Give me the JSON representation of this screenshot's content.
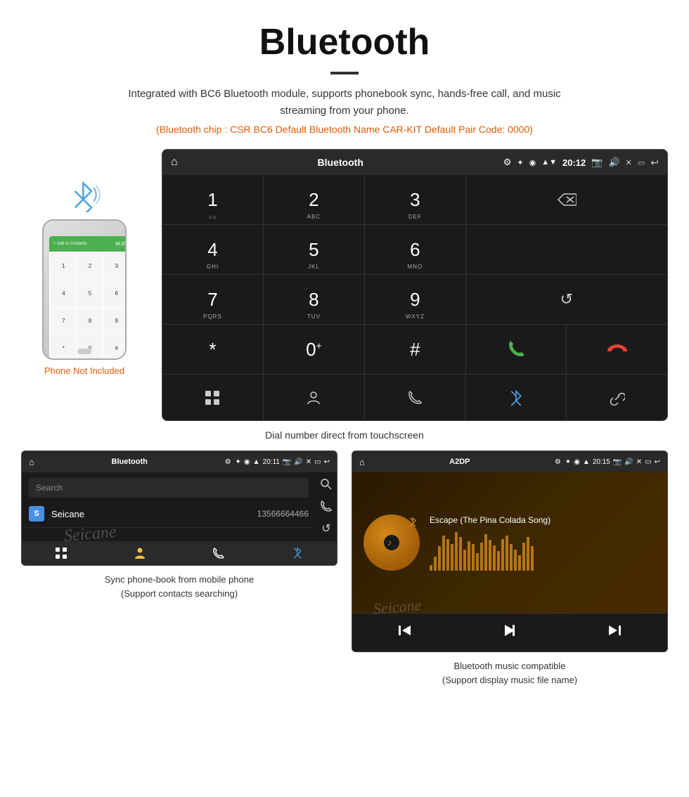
{
  "header": {
    "title": "Bluetooth",
    "desc": "Integrated with BC6 Bluetooth module, supports phonebook sync, hands-free call, and music streaming from your phone.",
    "specs": "(Bluetooth chip : CSR BC6     Default Bluetooth Name CAR-KIT     Default Pair Code: 0000)"
  },
  "dial_screen": {
    "status_bar": {
      "home_icon": "⌂",
      "title": "Bluetooth",
      "usb_icon": "⚲",
      "bt_icon": "✦",
      "location_icon": "◉",
      "signal_icon": "▼",
      "time": "20:12",
      "camera_icon": "📷",
      "volume_icon": "🔊",
      "x_icon": "✕",
      "window_icon": "▭",
      "back_icon": "↩"
    },
    "keys": [
      {
        "num": "1",
        "sub": "⌂⌂"
      },
      {
        "num": "2",
        "sub": "ABC"
      },
      {
        "num": "3",
        "sub": "DEF"
      },
      {
        "num": "4",
        "sub": "GHI"
      },
      {
        "num": "5",
        "sub": "JKL"
      },
      {
        "num": "6",
        "sub": "MNO"
      },
      {
        "num": "7",
        "sub": "PQRS"
      },
      {
        "num": "8",
        "sub": "TUV"
      },
      {
        "num": "9",
        "sub": "WXYZ"
      },
      {
        "num": "*",
        "sub": ""
      },
      {
        "num": "0",
        "sub": "+"
      },
      {
        "num": "#",
        "sub": ""
      }
    ],
    "caption": "Dial number direct from touchscreen"
  },
  "phonebook_screen": {
    "status_bar_title": "Bluetooth",
    "time": "20:11",
    "search_placeholder": "Search",
    "contact": {
      "letter": "S",
      "name": "Seicane",
      "number": "13566664466"
    },
    "caption_line1": "Sync phone-book from mobile phone",
    "caption_line2": "(Support contacts searching)"
  },
  "music_screen": {
    "status_bar_title": "A2DP",
    "time": "20:15",
    "song_title": "Escape (The Pina Colada Song)",
    "caption_line1": "Bluetooth music compatible",
    "caption_line2": "(Support display music file name)"
  },
  "phone_label": "Phone Not Included",
  "watermark": "Seicane",
  "icons": {
    "bluetooth": "✦",
    "call_green": "📞",
    "call_red": "📵",
    "back": "⌫",
    "refresh": "↺",
    "grid": "⊞",
    "person": "👤",
    "phone": "📱",
    "link": "🔗",
    "search": "🔍",
    "skip_prev": "⏮",
    "play": "⏵⏸",
    "skip_next": "⏭"
  },
  "viz_bars": [
    8,
    20,
    35,
    50,
    45,
    38,
    55,
    48,
    30,
    42,
    38,
    25,
    40,
    52,
    44,
    36,
    28,
    45,
    50,
    38,
    30,
    22,
    40,
    48,
    35
  ]
}
